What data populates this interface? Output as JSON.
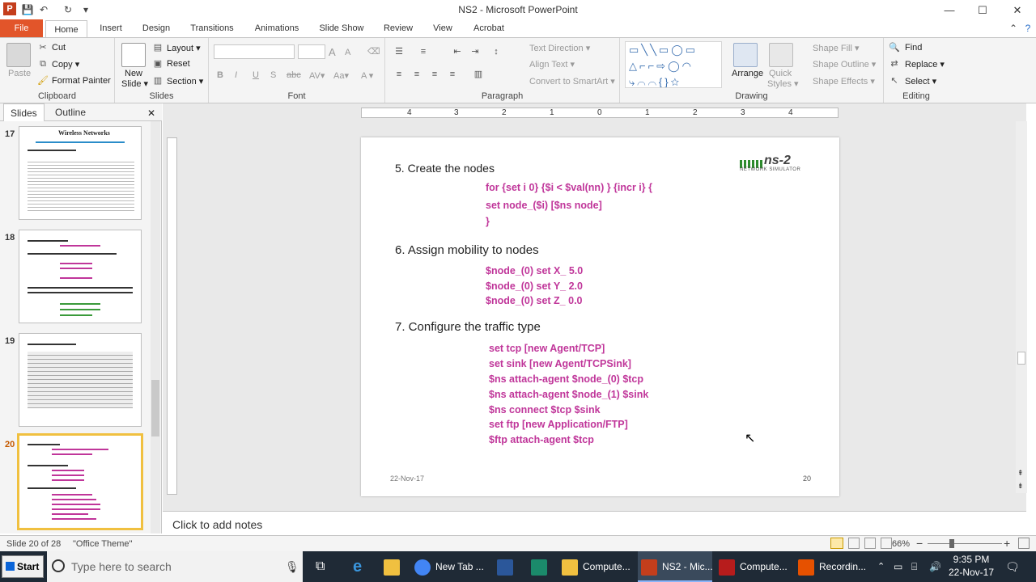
{
  "window": {
    "title": "NS2 - Microsoft PowerPoint"
  },
  "quick_access": {
    "save": "💾",
    "undo": "↶",
    "redo": "↻",
    "customize": "▾"
  },
  "window_buttons": {
    "minimize": "—",
    "maximize": "☐",
    "close": "✕"
  },
  "tabs": {
    "file": "File",
    "items": [
      "Home",
      "Insert",
      "Design",
      "Transitions",
      "Animations",
      "Slide Show",
      "Review",
      "View",
      "Acrobat"
    ]
  },
  "ribbon": {
    "clipboard": {
      "label": "Clipboard",
      "paste": "Paste",
      "cut": "Cut",
      "copy": "Copy ▾",
      "format_painter": "Format Painter"
    },
    "slides": {
      "label": "Slides",
      "new_slide": "New",
      "new_slide2": "Slide ▾",
      "layout": "Layout ▾",
      "reset": "Reset",
      "section": "Section ▾"
    },
    "font": {
      "label": "Font",
      "bold": "B",
      "italic": "I",
      "underline": "U",
      "shadow": "S",
      "strike": "abc",
      "spacing": "AV▾",
      "case": "Aa▾",
      "color": "A ▾",
      "grow": "A",
      "shrink": "A"
    },
    "paragraph": {
      "label": "Paragraph",
      "text_direction": "Text Direction ▾",
      "align_text": "Align Text ▾",
      "convert_smartart": "Convert to SmartArt ▾"
    },
    "drawing": {
      "label": "Drawing",
      "arrange": "Arrange",
      "quick_styles": "Quick",
      "quick_styles2": "Styles ▾",
      "shape_fill": "Shape Fill ▾",
      "shape_outline": "Shape Outline ▾",
      "shape_effects": "Shape Effects ▾"
    },
    "editing": {
      "label": "Editing",
      "find": "Find",
      "replace": "Replace ▾",
      "select": "Select ▾"
    }
  },
  "left_pane": {
    "tab_slides": "Slides",
    "tab_outline": "Outline",
    "close": "✕",
    "thumbs": [
      {
        "num": "17",
        "title": "Wireless Networks"
      },
      {
        "num": "18",
        "title": ""
      },
      {
        "num": "19",
        "title": ""
      },
      {
        "num": "20",
        "title": ""
      }
    ]
  },
  "ruler": {
    "labels": [
      "4",
      "3",
      "2",
      "1",
      "0",
      "1",
      "2",
      "3",
      "4"
    ]
  },
  "slide": {
    "logo_text": "ns-2",
    "logo_sub": "NETWORK SIMULATOR",
    "h5": "5. Create the nodes",
    "code5": [
      "for  {set i 0}  {$i < $val(nn) }  {incr i}  {",
      "set node_($i) [$ns  node]",
      "}"
    ],
    "h6": "6. Assign mobility to nodes",
    "code6": [
      "$node_(0) set X_ 5.0",
      "$node_(0) set Y_ 2.0",
      "$node_(0) set Z_ 0.0"
    ],
    "h7": "7. Configure the traffic type",
    "code7": [
      "set  tcp [new Agent/TCP]",
      "set  sink [new Agent/TCPSink]",
      "$ns  attach-agent $node_(0)  $tcp",
      "$ns  attach-agent $node_(1)  $sink",
      "$ns  connect $tcp $sink",
      "set ftp [new Application/FTP]",
      "$ftp attach-agent $tcp"
    ],
    "date": "22-Nov-17",
    "number": "20"
  },
  "notes": {
    "placeholder": "Click to add notes"
  },
  "status": {
    "slide_info": "Slide 20 of 28",
    "theme": "\"Office Theme\"",
    "zoom": "66%",
    "zoom_minus": "−",
    "zoom_plus": "+"
  },
  "taskbar": {
    "start": "Start",
    "search_placeholder": "Type here to search",
    "items": [
      {
        "label": "New Tab ...",
        "color": "#4285f4"
      },
      {
        "label": "Compute...",
        "color": "#f0c040"
      },
      {
        "label": "NS2 - Mic...",
        "color": "#c43e1c"
      },
      {
        "label": "Compute...",
        "color": "#b71c1c"
      },
      {
        "label": "Recordin...",
        "color": "#e65100"
      }
    ],
    "time": "9:35 PM",
    "date": "22-Nov-17"
  }
}
